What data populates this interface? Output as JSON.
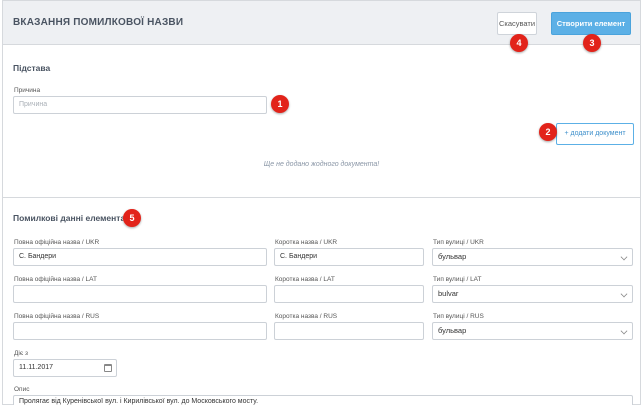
{
  "header": {
    "title": "ВКАЗАННЯ ПОМИЛКОВОЇ НАЗВИ",
    "cancel_label": "Скасувати",
    "create_label": "Створити елемент"
  },
  "basis": {
    "section_title": "Підстава",
    "reason_label": "Причина",
    "reason_placeholder": "Причина",
    "add_document_label": "+ додати документ",
    "empty_message": "Ще не додано жодного документа!"
  },
  "erroneous": {
    "section_title": "Помилкові данні елемента",
    "rows": [
      {
        "full_label": "Повна офіційна назва / UKR",
        "full_value": "С. Бандери",
        "short_label": "Коротка назва / UKR",
        "short_value": "С. Бандери",
        "type_label": "Тип вулиці / UKR",
        "type_value": "бульвар"
      },
      {
        "full_label": "Повна офіційна назва / LAT",
        "full_value": "",
        "short_label": "Коротка назва / LAT",
        "short_value": "",
        "type_label": "Тип вулиці / LAT",
        "type_value": "bulvar"
      },
      {
        "full_label": "Повна офіційна назва / RUS",
        "full_value": "",
        "short_label": "Коротка назва / RUS",
        "short_value": "",
        "type_label": "Тип вулиці / RUS",
        "type_value": "бульвар"
      }
    ],
    "valid_from_label": "Діє з",
    "valid_from_value": "11.11.2017",
    "description_label": "Опис",
    "description_value": "Пролягає від Куренівської вул. і Кирилівської вул. до Московського мосту."
  },
  "badges": {
    "b1": "1",
    "b2": "2",
    "b3": "3",
    "b4": "4",
    "b5": "5"
  },
  "colors": {
    "primary": "#5cb0e6",
    "badge": "#e2231a",
    "header_bg": "#eef0f3"
  }
}
